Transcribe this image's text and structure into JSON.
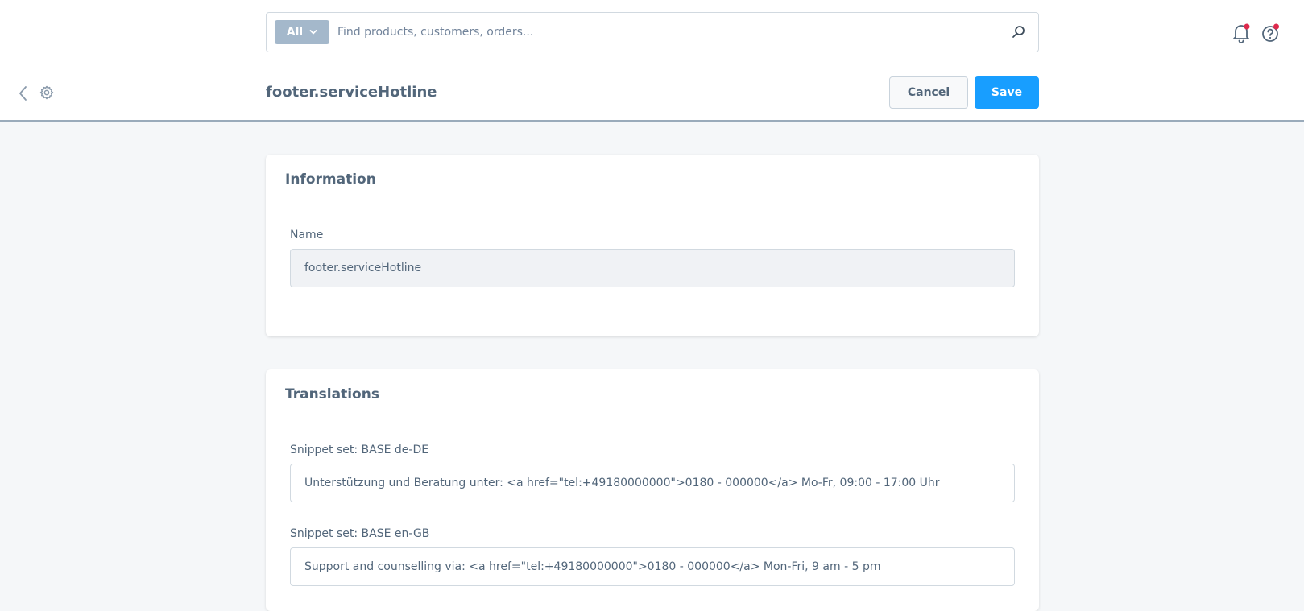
{
  "search": {
    "type_label": "All",
    "placeholder": "Find products, customers, orders..."
  },
  "icons": {
    "search": "search-icon",
    "notifications": "bell-icon",
    "help": "help-icon",
    "back": "chevron-left-icon",
    "settings": "gear-icon",
    "dropdown": "chevron-down-icon"
  },
  "colors": {
    "primary": "#189eff",
    "notification_dot": "#de294c",
    "search_type_bg": "#a4b8cb"
  },
  "header": {
    "title": "footer.serviceHotline",
    "cancel_label": "Cancel",
    "save_label": "Save"
  },
  "information": {
    "title": "Information",
    "name_label": "Name",
    "name_value": "footer.serviceHotline"
  },
  "translations": {
    "title": "Translations",
    "items": [
      {
        "label": "Snippet set: BASE de-DE",
        "value": "Unterstützung und Beratung unter: <a href=\"tel:+49180000000\">0180 - 000000</a> Mo-Fr, 09:00 - 17:00 Uhr"
      },
      {
        "label": "Snippet set: BASE en-GB",
        "value": "Support and counselling via: <a href=\"tel:+49180000000\">0180 - 000000</a> Mon-Fri, 9 am - 5 pm"
      }
    ]
  }
}
